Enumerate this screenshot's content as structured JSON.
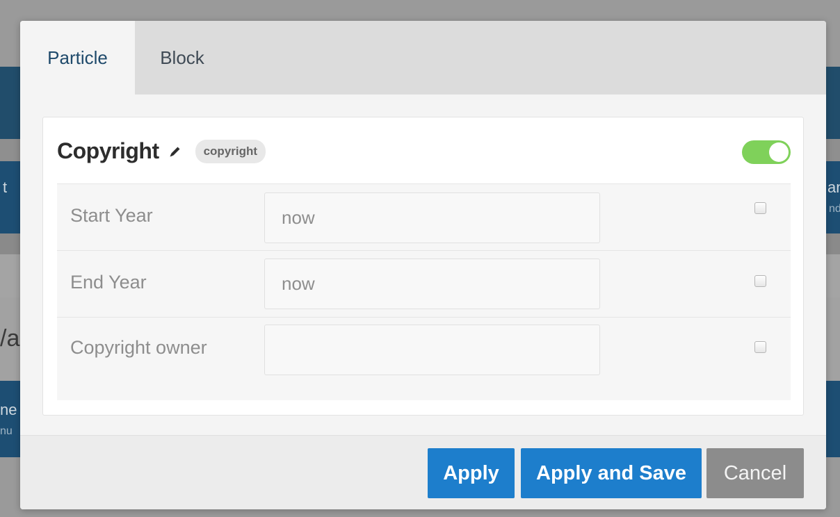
{
  "background_page": {
    "fragments": [
      "t",
      "an",
      "nd",
      "/a",
      "ne",
      "nu"
    ]
  },
  "modal": {
    "tabs": [
      {
        "label": "Particle",
        "active": true
      },
      {
        "label": "Block",
        "active": false
      }
    ],
    "particle": {
      "title": "Copyright",
      "type_badge": "copyright",
      "enabled": true,
      "fields": [
        {
          "label": "Start Year",
          "value": "",
          "placeholder": "now",
          "override": false
        },
        {
          "label": "End Year",
          "value": "",
          "placeholder": "now",
          "override": false
        },
        {
          "label": "Copyright owner",
          "value": "",
          "placeholder": "",
          "override": false
        }
      ]
    },
    "footer": {
      "apply_label": "Apply",
      "apply_save_label": "Apply and Save",
      "cancel_label": "Cancel"
    }
  },
  "colors": {
    "primary_button": "#1d7ecc",
    "cancel_button": "#8c8c8c",
    "toggle_on": "#7fd15a",
    "active_tab_text": "#1f4a6b"
  }
}
